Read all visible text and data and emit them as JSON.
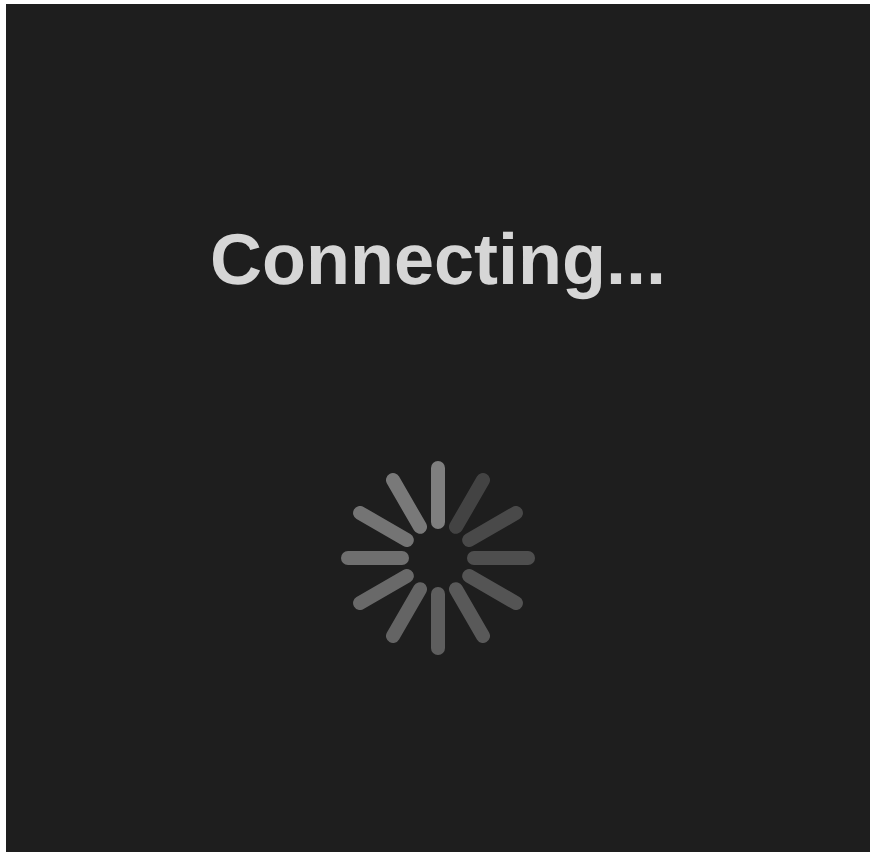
{
  "status": {
    "text": "Connecting..."
  }
}
